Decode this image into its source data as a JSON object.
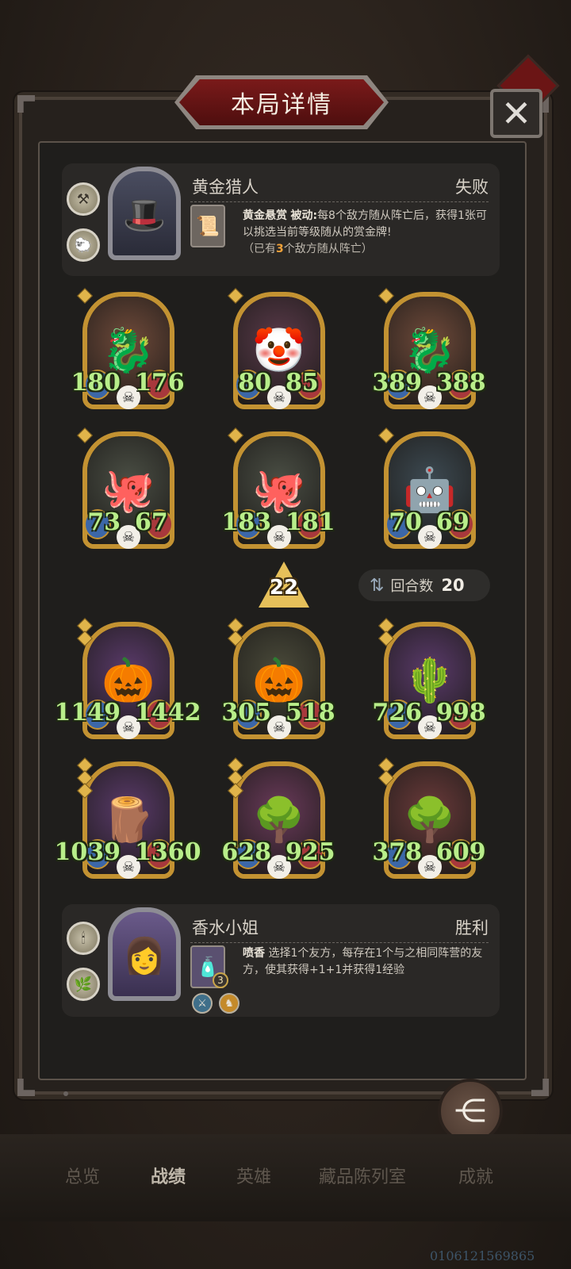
{
  "header": {
    "title": "本局详情",
    "close_label": "✕"
  },
  "top_player": {
    "name": "黄金猎人",
    "result": "失败",
    "skill_name": "黄金悬赏",
    "skill_type": "被动:",
    "skill_text": "每8个敌方随从阵亡后，获得1张可以挑选当前等级随从的赏金牌!",
    "progress_prefix": "（已有",
    "progress_count": "3",
    "progress_suffix": "个敌方随从阵亡）"
  },
  "enemy_minions": [
    {
      "attack": "180",
      "health": "176",
      "stars": 1,
      "color": "#6f4a3a",
      "icon": "dragon-icon",
      "glyph": "🐉"
    },
    {
      "attack": "80",
      "health": "85",
      "stars": 1,
      "color": "#5a3a4a",
      "icon": "clown-icon",
      "glyph": "🤡"
    },
    {
      "attack": "389",
      "health": "388",
      "stars": 1,
      "color": "#6f4a3a",
      "icon": "dragon-icon",
      "glyph": "🐉"
    },
    {
      "attack": "73",
      "health": "67",
      "stars": 1,
      "color": "#4a4e44",
      "icon": "robot-octopus-icon",
      "glyph": "🐙"
    },
    {
      "attack": "183",
      "health": "181",
      "stars": 1,
      "color": "#4a4e44",
      "icon": "robot-octopus-icon",
      "glyph": "🐙"
    },
    {
      "attack": "70",
      "health": "69",
      "stars": 1,
      "color": "#3d4a52",
      "icon": "mech-robot-icon",
      "glyph": "🤖"
    }
  ],
  "tier": "22",
  "rounds": {
    "label": "回合数",
    "value": "20"
  },
  "player_minions": [
    {
      "attack": "1149",
      "health": "1442",
      "stars": 2,
      "color": "#5a3a6a",
      "icon": "pumpkin-icon",
      "glyph": "🎃"
    },
    {
      "attack": "305",
      "health": "518",
      "stars": 2,
      "color": "#4a4a3a",
      "icon": "pumpkin-icon",
      "glyph": "🎃"
    },
    {
      "attack": "726",
      "health": "998",
      "stars": 2,
      "color": "#5a3a6a",
      "icon": "cactus-icon",
      "glyph": "🌵"
    },
    {
      "attack": "1039",
      "health": "1360",
      "stars": 3,
      "color": "#5a3a6a",
      "icon": "tree-stump-icon",
      "glyph": "🪵"
    },
    {
      "attack": "628",
      "health": "925",
      "stars": 3,
      "color": "#6a3a5a",
      "icon": "treant-icon",
      "glyph": "🌳"
    },
    {
      "attack": "378",
      "health": "609",
      "stars": 2,
      "color": "#6a3a3a",
      "icon": "treant-icon",
      "glyph": "🌳"
    }
  ],
  "bottom_player": {
    "name": "香水小姐",
    "result": "胜利",
    "skill_name": "喷香",
    "skill_text": "选择1个友方，每存在1个与之相同阵营的友方，使其获得+1+1并获得1经验",
    "skill_level": "3"
  },
  "share_label": "分享",
  "nav": [
    "总览",
    "战绩",
    "英雄",
    "藏品陈列室",
    "成就"
  ],
  "uid": "0106121569865"
}
